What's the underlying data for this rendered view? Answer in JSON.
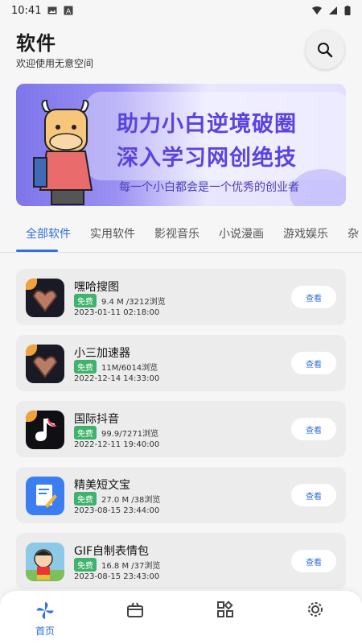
{
  "status_bar": {
    "time": "10:41"
  },
  "header": {
    "title": "软件",
    "subtitle": "欢迎使用无意空间"
  },
  "banner": {
    "line1": "助力小白逆境破圈",
    "line2": "深入学习网创绝技",
    "tagline": "每一个小白都会是一个优秀的创业者"
  },
  "tabs": [
    "全部软件",
    "实用软件",
    "影视音乐",
    "小说漫画",
    "游戏娱乐",
    "杂"
  ],
  "apps": [
    {
      "name": "嘿哈搜图",
      "badge": "免费",
      "size_views": "9.4 M /3212浏览",
      "date": "2023-01-11 02:18:00",
      "button": "查看"
    },
    {
      "name": "小三加速器",
      "badge": "免费",
      "size_views": "11M/6014浏览",
      "date": "2022-12-14 14:33:00",
      "button": "查看"
    },
    {
      "name": "国际抖音",
      "badge": "免费",
      "size_views": "99.9/7271浏览",
      "date": "2022-12-11 19:40:00",
      "button": "查看"
    },
    {
      "name": "精美短文宝",
      "badge": "免费",
      "size_views": "27.0 M /38浏览",
      "date": "2023-08-15 23:44:00",
      "button": "查看"
    },
    {
      "name": "GIF自制表情包",
      "badge": "免费",
      "size_views": "16.8 M /37浏览",
      "date": "2023-08-15 23:43:00",
      "button": "查看"
    }
  ],
  "bottom_nav": {
    "home_label": "首页"
  },
  "colors": {
    "accent": "#2f6fe0",
    "badge": "#3fb26b",
    "banner_text": "#5a43e0"
  }
}
